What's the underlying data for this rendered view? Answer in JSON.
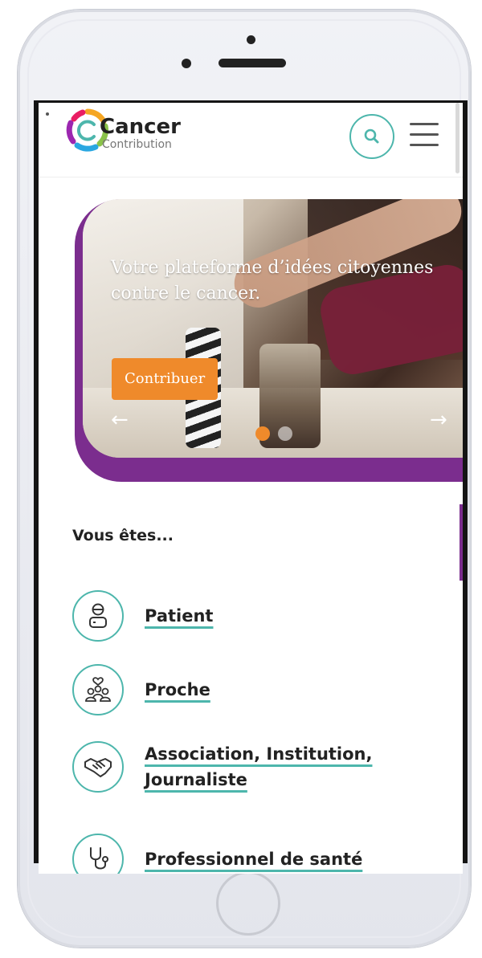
{
  "site": {
    "logo_name": "Cancer",
    "logo_subtitle": "Contribution"
  },
  "header": {
    "search_icon": "search-icon",
    "menu_icon": "hamburger-menu-icon"
  },
  "hero": {
    "title": "Votre plateforme d’idées citoyennes contre le cancer.",
    "cta_label": "Contribuer",
    "prev_arrow": "←",
    "next_arrow": "→",
    "slides_total": 2,
    "slide_active": 1
  },
  "section": {
    "title": "Vous êtes...",
    "roles": [
      {
        "label": "Patient",
        "icon": "patient-icon"
      },
      {
        "label": "Proche",
        "icon": "family-icon"
      },
      {
        "label": "Association, Institution, Journaliste",
        "icon": "handshake-icon"
      },
      {
        "label": "Professionnel de santé",
        "icon": "stethoscope-icon"
      }
    ]
  },
  "colors": {
    "accent_teal": "#4db6ac",
    "brand_purple": "#7b2d8e",
    "cta_orange": "#ef8a2b",
    "text_dark": "#222222"
  }
}
